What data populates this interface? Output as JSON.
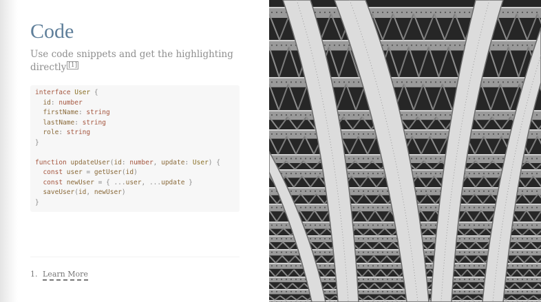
{
  "slide": {
    "title": "Code",
    "subtitle": "Use code snippets and get the highlighting directly",
    "footnote_ref": "[1]"
  },
  "code": {
    "lines": [
      [
        {
          "t": "interface",
          "c": "kw"
        },
        {
          "t": " "
        },
        {
          "t": "User",
          "c": "ty"
        },
        {
          "t": " {",
          "c": "pn"
        }
      ],
      [
        {
          "t": "  "
        },
        {
          "t": "id",
          "c": "idf"
        },
        {
          "t": ": ",
          "c": "pn"
        },
        {
          "t": "number",
          "c": "kw"
        }
      ],
      [
        {
          "t": "  "
        },
        {
          "t": "firstName",
          "c": "idf"
        },
        {
          "t": ": ",
          "c": "pn"
        },
        {
          "t": "string",
          "c": "kw"
        }
      ],
      [
        {
          "t": "  "
        },
        {
          "t": "lastName",
          "c": "idf"
        },
        {
          "t": ": ",
          "c": "pn"
        },
        {
          "t": "string",
          "c": "kw"
        }
      ],
      [
        {
          "t": "  "
        },
        {
          "t": "role",
          "c": "idf"
        },
        {
          "t": ": ",
          "c": "pn"
        },
        {
          "t": "string",
          "c": "kw"
        }
      ],
      [
        {
          "t": "}",
          "c": "pn"
        }
      ],
      [
        {
          "t": ""
        }
      ],
      [
        {
          "t": "function",
          "c": "kw"
        },
        {
          "t": " "
        },
        {
          "t": "updateUser",
          "c": "idf"
        },
        {
          "t": "(",
          "c": "pn"
        },
        {
          "t": "id",
          "c": "idf"
        },
        {
          "t": ": ",
          "c": "pn"
        },
        {
          "t": "number",
          "c": "kw"
        },
        {
          "t": ", ",
          "c": "pn"
        },
        {
          "t": "update",
          "c": "idf"
        },
        {
          "t": ": ",
          "c": "pn"
        },
        {
          "t": "User",
          "c": "ty"
        },
        {
          "t": ") {",
          "c": "pn"
        }
      ],
      [
        {
          "t": "  "
        },
        {
          "t": "const",
          "c": "kw"
        },
        {
          "t": " "
        },
        {
          "t": "user",
          "c": "idf"
        },
        {
          "t": " = ",
          "c": "pn"
        },
        {
          "t": "getUser",
          "c": "idf"
        },
        {
          "t": "(",
          "c": "pn"
        },
        {
          "t": "id",
          "c": "idf"
        },
        {
          "t": ")",
          "c": "pn"
        }
      ],
      [
        {
          "t": "  "
        },
        {
          "t": "const",
          "c": "kw"
        },
        {
          "t": " "
        },
        {
          "t": "newUser",
          "c": "idf"
        },
        {
          "t": " = { ...",
          "c": "pn"
        },
        {
          "t": "user",
          "c": "idf"
        },
        {
          "t": ", ...",
          "c": "pn"
        },
        {
          "t": "update",
          "c": "idf"
        },
        {
          "t": " }",
          "c": "pn"
        }
      ],
      [
        {
          "t": "  "
        },
        {
          "t": "saveUser",
          "c": "idf"
        },
        {
          "t": "(",
          "c": "pn"
        },
        {
          "t": "id",
          "c": "idf"
        },
        {
          "t": ", ",
          "c": "pn"
        },
        {
          "t": "newUser",
          "c": "idf"
        },
        {
          "t": ")",
          "c": "pn"
        }
      ],
      [
        {
          "t": "}",
          "c": "pn"
        }
      ]
    ]
  },
  "footnotes": [
    {
      "number": "1.",
      "link_label": "Learn More"
    }
  ],
  "colors": {
    "title": "#5f7f9a",
    "keyword": "#a4553e",
    "type": "#8a7028",
    "code_background": "#f7f7f7",
    "photo_dark": "#2a2a2a",
    "photo_light": "#d8d8d8"
  },
  "image": {
    "subject": "steel-bridge-underside-photo"
  }
}
